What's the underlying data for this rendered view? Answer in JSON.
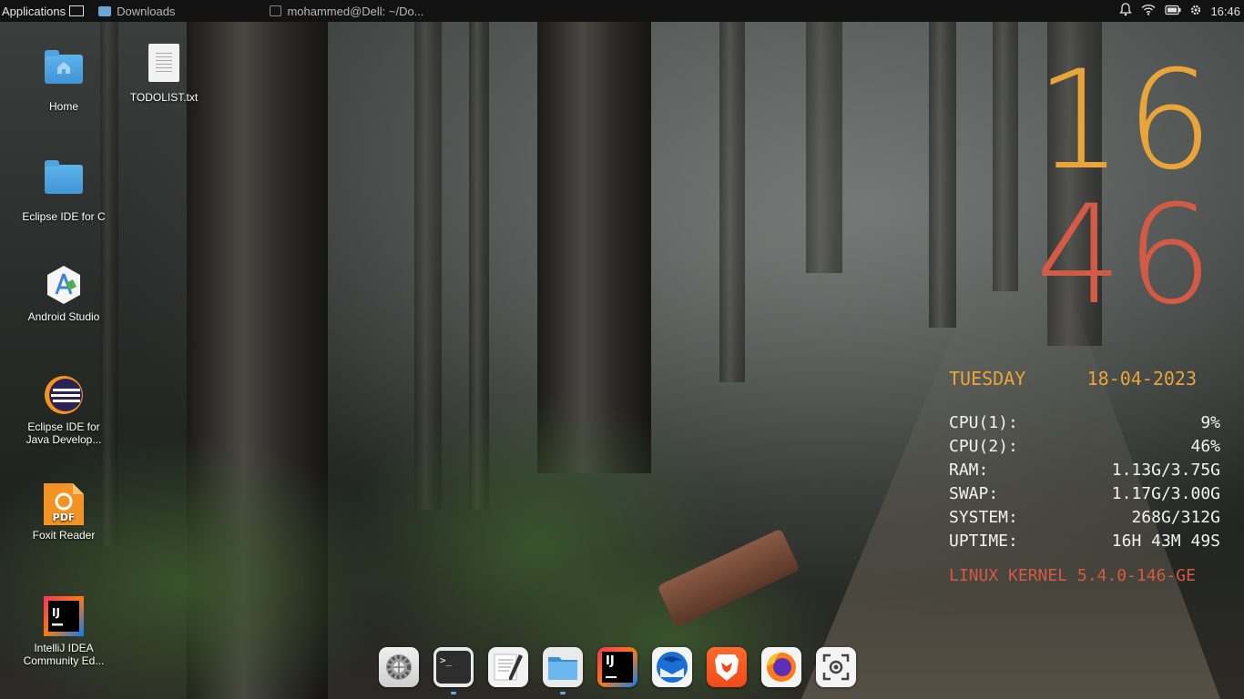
{
  "panel": {
    "applications": "Applications",
    "tasks": [
      {
        "label": "Downloads",
        "icon": "folder-icon"
      },
      {
        "label": "mohammed@Dell: ~/Do...",
        "icon": "terminal-icon"
      }
    ],
    "clock": "16:46",
    "tray_icons": [
      "bell-icon",
      "wifi-icon",
      "battery-icon",
      "settings-icon"
    ]
  },
  "desktop_icons": [
    {
      "label": "Home",
      "icon": "home-folder-icon"
    },
    {
      "label": "TODOLIST.txt",
      "icon": "text-file-icon"
    },
    {
      "label": "Eclipse IDE for C",
      "icon": "folder-icon"
    },
    {
      "label": "Android Studio",
      "icon": "android-studio-icon"
    },
    {
      "label": "Eclipse IDE for Java Develop...",
      "icon": "eclipse-icon"
    },
    {
      "label": "Foxit Reader",
      "icon": "foxit-pdf-icon"
    },
    {
      "label": "IntelliJ IDEA Community Ed...",
      "icon": "intellij-icon"
    }
  ],
  "conky": {
    "hour": "16",
    "minute": "46",
    "day": "TUESDAY",
    "date": "18-04-2023",
    "stats": [
      {
        "label": "CPU(1):",
        "value": "9%"
      },
      {
        "label": "CPU(2):",
        "value": "46%"
      },
      {
        "label": "RAM:",
        "value": "1.13G/3.75G"
      },
      {
        "label": "SWAP:",
        "value": "1.17G/3.00G"
      },
      {
        "label": "SYSTEM:",
        "value": "268G/312G"
      },
      {
        "label": "UPTIME:",
        "value": "16H 43M 49S"
      }
    ],
    "kernel": "LINUX KERNEL 5.4.0-146-GE",
    "colors": {
      "hour": "#e9a53a",
      "minute": "#d35a45"
    }
  },
  "dock": [
    {
      "name": "settings",
      "icon": "settings-gear-icon"
    },
    {
      "name": "terminal",
      "icon": "terminal-icon",
      "glyph": ">_"
    },
    {
      "name": "text-editor",
      "icon": "text-editor-icon"
    },
    {
      "name": "files",
      "icon": "files-icon"
    },
    {
      "name": "intellij",
      "icon": "intellij-icon",
      "glyph": "IJ"
    },
    {
      "name": "thunderbird",
      "icon": "thunderbird-icon"
    },
    {
      "name": "brave",
      "icon": "brave-icon"
    },
    {
      "name": "firefox",
      "icon": "firefox-icon"
    },
    {
      "name": "screenshot",
      "icon": "screenshot-icon"
    }
  ]
}
